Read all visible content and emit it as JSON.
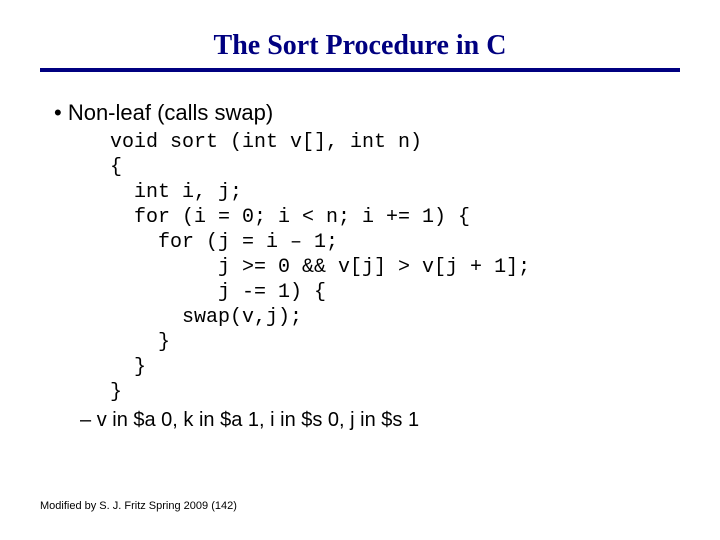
{
  "title": "The Sort Procedure in C",
  "bullet1": "Non-leaf (calls swap)",
  "code": "void sort (int v[], int n)\n{\n  int i, j;\n  for (i = 0; i < n; i += 1) {\n    for (j = i – 1;\n         j >= 0 && v[j] > v[j + 1];\n         j -= 1) {\n      swap(v,j);\n    }\n  }\n}",
  "sub1": "v in $a 0, k in $a 1, i in $s 0, j in $s 1",
  "footer": "Modified by S. J. Fritz  Spring 2009 (142)"
}
